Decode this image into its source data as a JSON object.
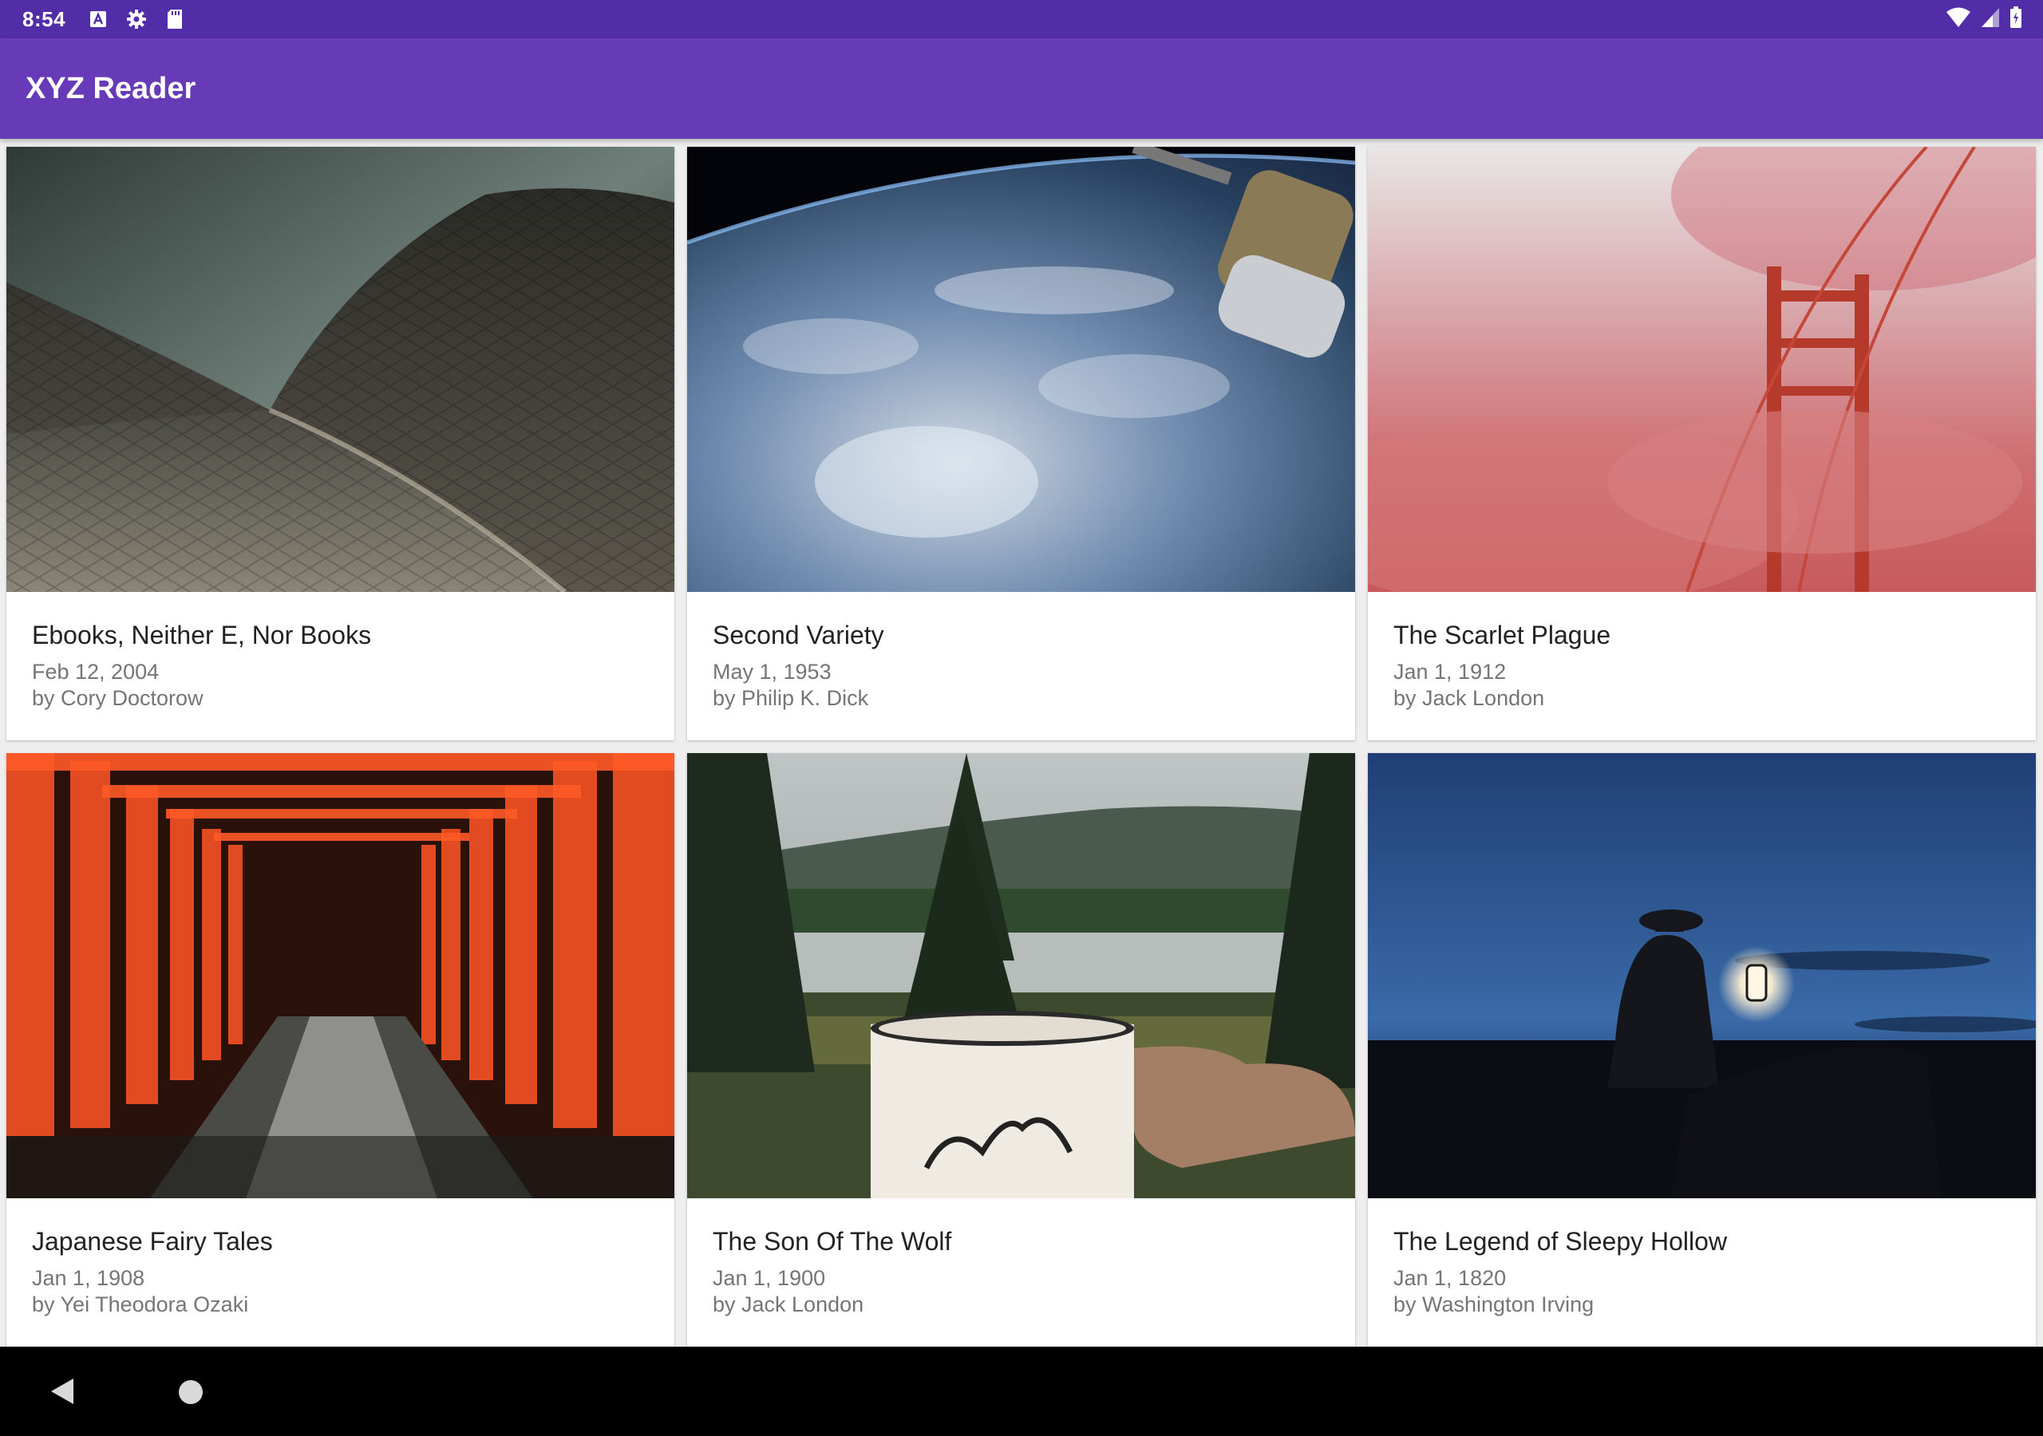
{
  "status_bar": {
    "time": "8:54",
    "background_color": "#512DA8",
    "left_icons": [
      "text-a-icon",
      "gear-icon",
      "sd-card-icon"
    ],
    "right_icons": [
      "wifi-icon",
      "signal-icon",
      "battery-icon"
    ]
  },
  "app_bar": {
    "title": "XYZ Reader",
    "background_color": "#673AB7"
  },
  "articles": [
    {
      "title": "Ebooks, Neither E, Nor Books",
      "date": "Feb 12, 2004",
      "author": "by Cory Doctorow",
      "thumbnail": "opera-house-roof-image"
    },
    {
      "title": "Second Variety",
      "date": "May 1, 1953",
      "author": "by Philip K. Dick",
      "thumbnail": "earth-from-space-image"
    },
    {
      "title": "The Scarlet Plague",
      "date": "Jan 1, 1912",
      "author": "by Jack London",
      "thumbnail": "bridge-in-fog-image"
    },
    {
      "title": "Japanese Fairy Tales",
      "date": "Jan 1, 1908",
      "author": "by Yei Theodora Ozaki",
      "thumbnail": "torii-gates-image"
    },
    {
      "title": "The Son Of The Wolf",
      "date": "Jan 1, 1900",
      "author": "by Jack London",
      "thumbnail": "mug-by-lake-image"
    },
    {
      "title": "The Legend of Sleepy Hollow",
      "date": "Jan 1, 1820",
      "author": "by Washington Irving",
      "thumbnail": "rider-with-lantern-image"
    }
  ],
  "nav_bar": {
    "buttons": [
      "back-icon",
      "home-icon"
    ]
  }
}
